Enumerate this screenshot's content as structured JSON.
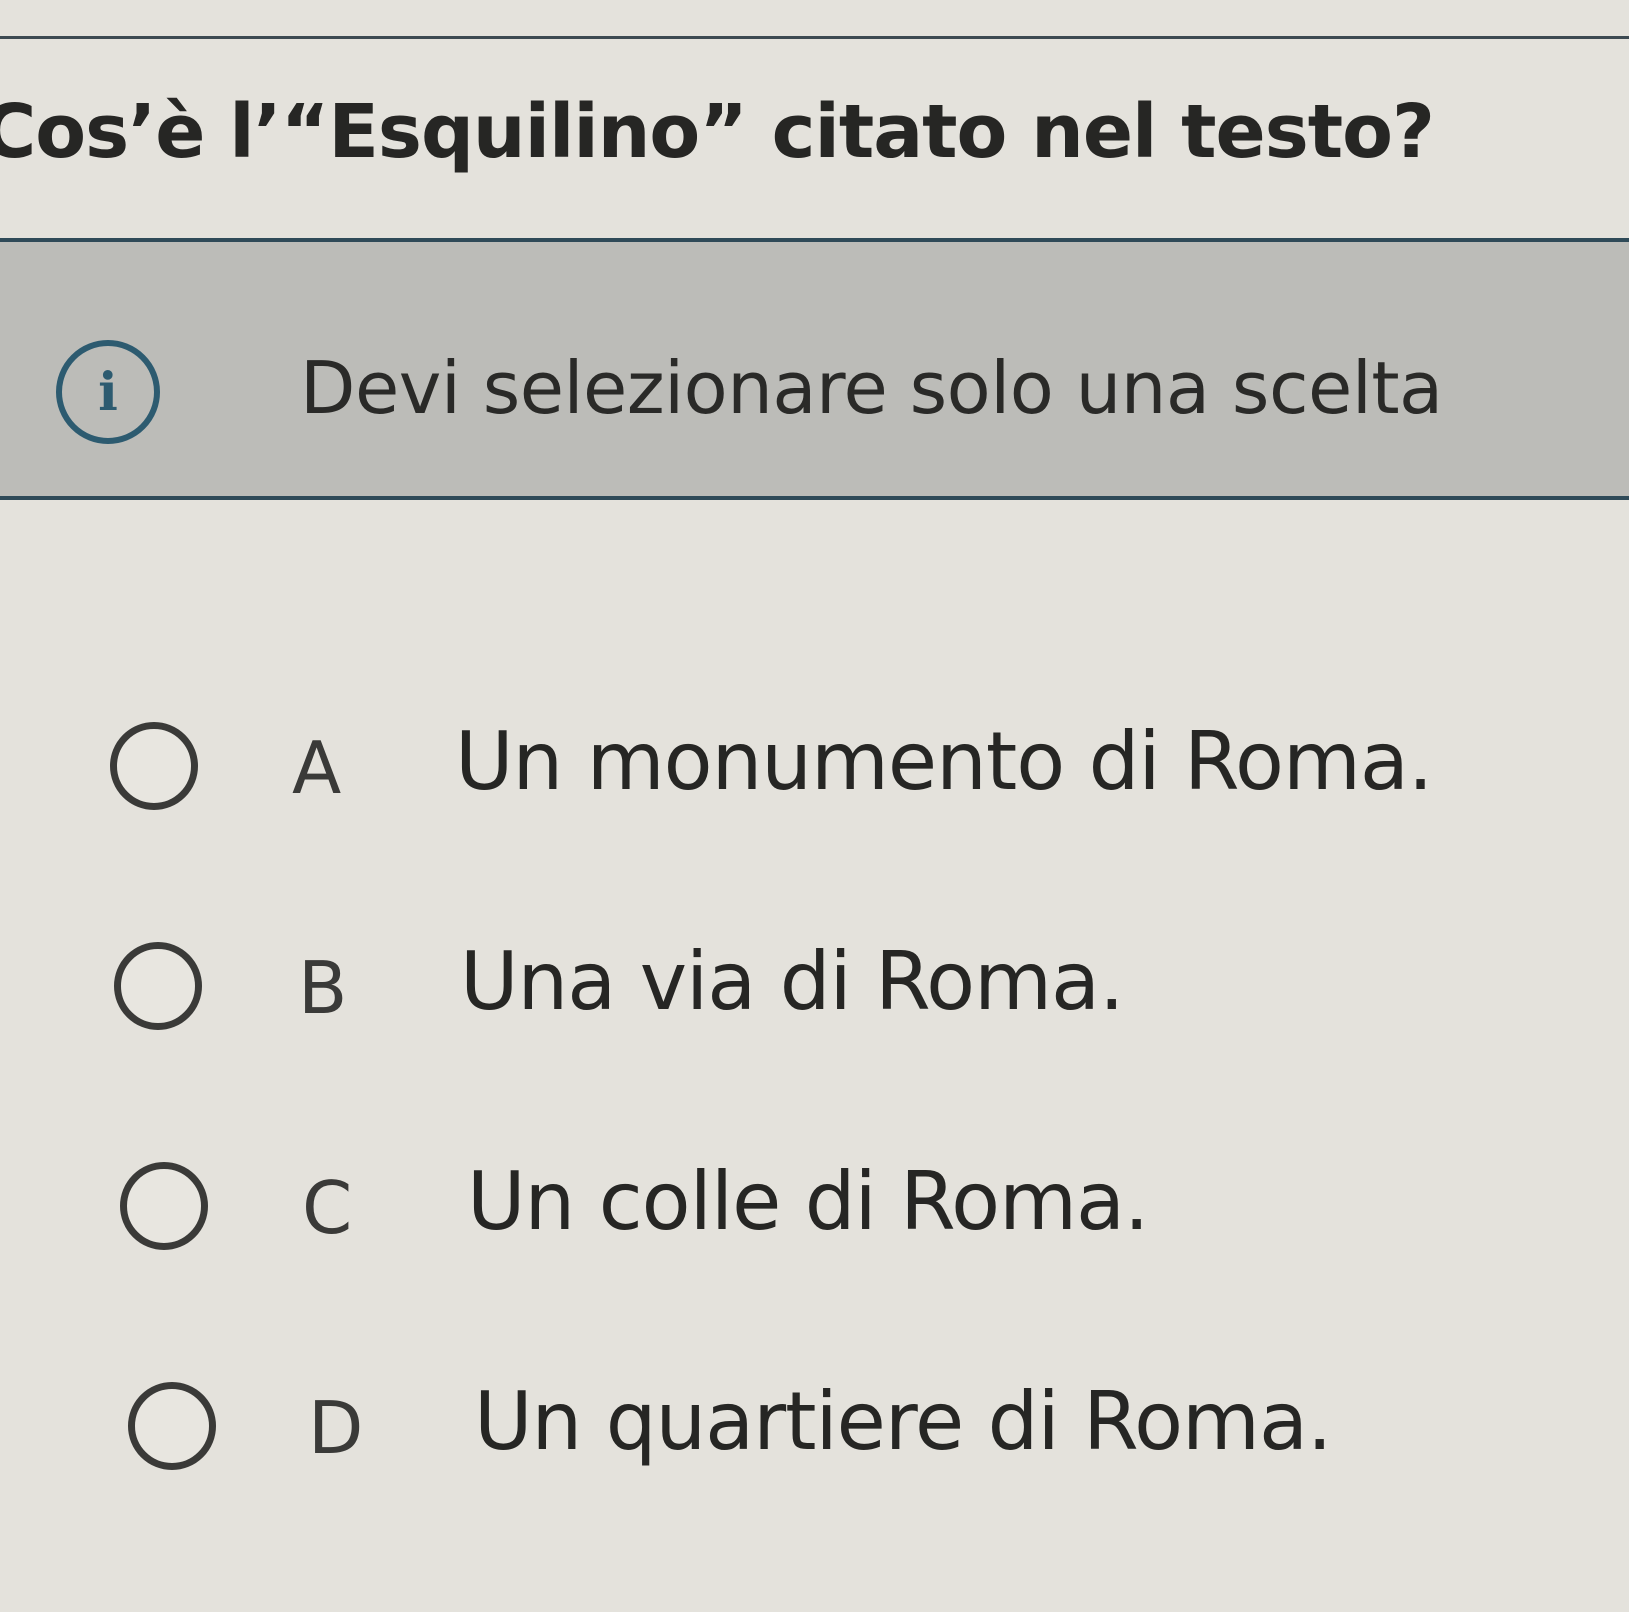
{
  "question": {
    "text": "Cos’è l’“Esquilino” citato nel testo?"
  },
  "info": {
    "icon": "info-icon",
    "icon_glyph": "i",
    "text": "Devi selezionare solo una scelta"
  },
  "options": [
    {
      "letter": "A",
      "text": "Un monumento di Roma."
    },
    {
      "letter": "B",
      "text": "Una via di Roma."
    },
    {
      "letter": "C",
      "text": "Un colle di Roma."
    },
    {
      "letter": "D",
      "text": "Un quartiere di Roma."
    }
  ],
  "colors": {
    "background": "#e4e2dc",
    "banner": "#bcbcb8",
    "accent": "#2d5b70"
  }
}
